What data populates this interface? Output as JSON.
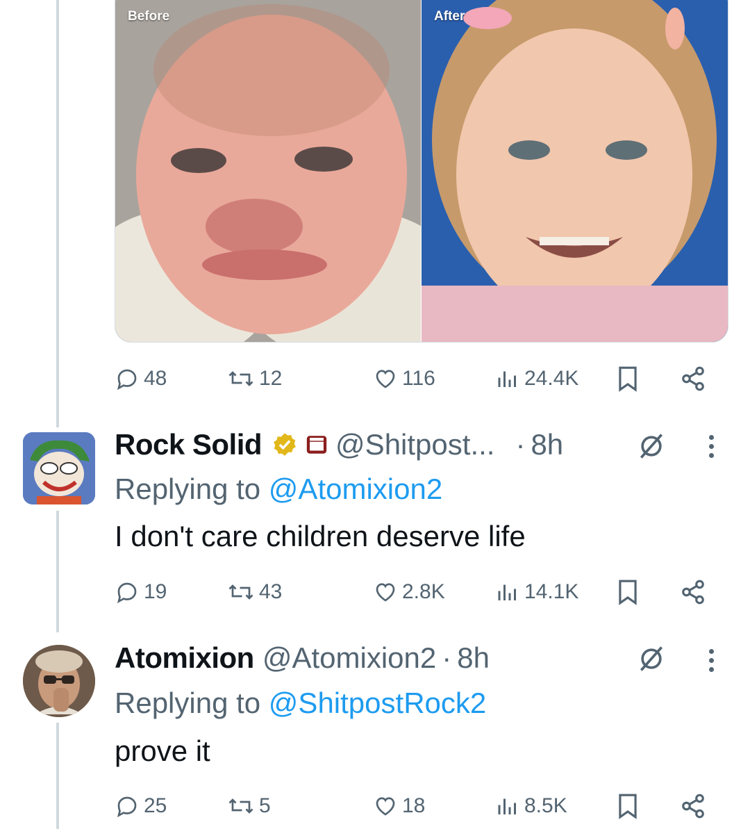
{
  "media": {
    "before_label": "Before",
    "after_label": "After",
    "actions": {
      "replies": "48",
      "reposts": "12",
      "likes": "116",
      "views": "24.4K"
    }
  },
  "tweets": [
    {
      "name": "Rock Solid",
      "handle": "@Shitpost...",
      "time": "8h",
      "dot": "·",
      "replying_prefix": "Replying to ",
      "replying_to": "@Atomixion2",
      "text": "I don't care children deserve life",
      "actions": {
        "replies": "19",
        "reposts": "43",
        "likes": "2.8K",
        "views": "14.1K"
      },
      "verified_color": "#e2b719"
    },
    {
      "name": "Atomixion",
      "handle": "@Atomixion2",
      "time": "8h",
      "dot": "·",
      "replying_prefix": "Replying to ",
      "replying_to": "@ShitpostRock2",
      "text": "prove it",
      "actions": {
        "replies": "25",
        "reposts": "5",
        "likes": "18",
        "views": "8.5K"
      }
    }
  ],
  "colors": {
    "secondary": "#536471",
    "link": "#1d9bf0",
    "thread_line": "#cfd9de"
  }
}
